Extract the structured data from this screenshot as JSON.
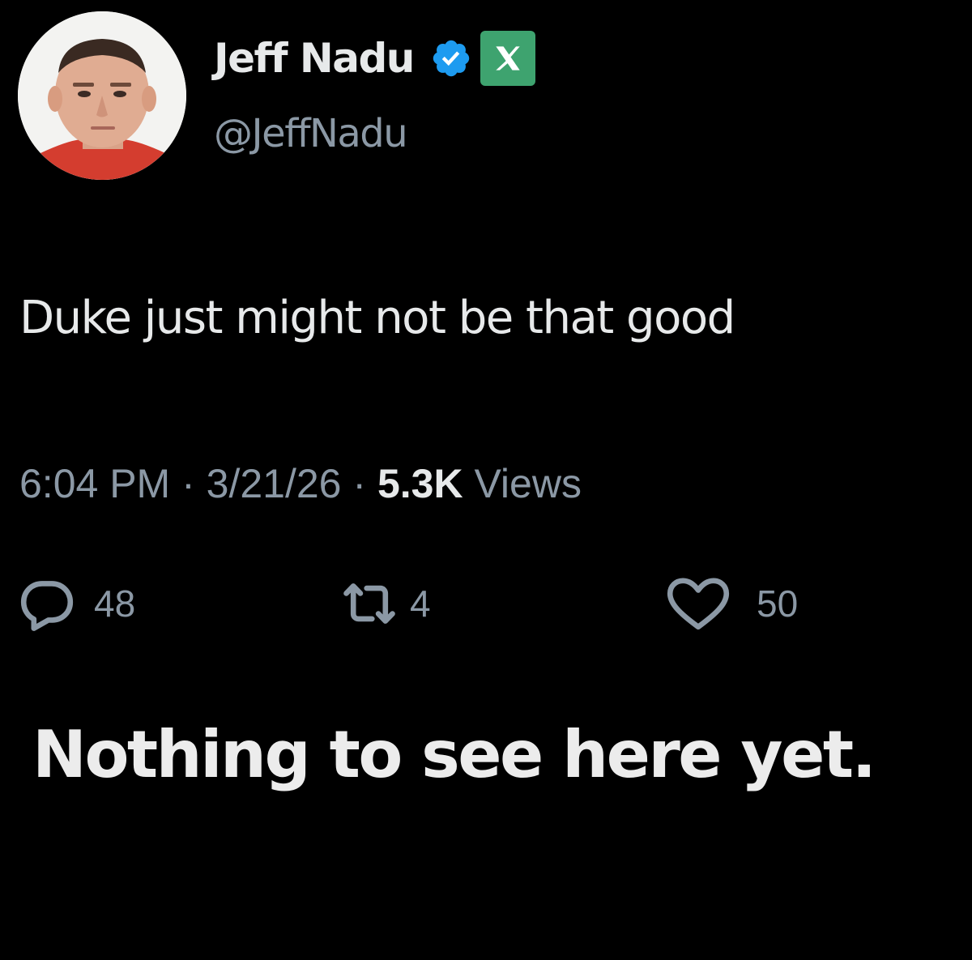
{
  "tweet": {
    "author": {
      "display_name": "Jeff Nadu",
      "handle": "@JeffNadu",
      "verified_icon": "verified-badge-icon",
      "affiliate_icon": "x-logo-icon",
      "badge_color": "#1d9bf0",
      "affiliate_color": "#3ea36f"
    },
    "text": "Duke just might not be that good",
    "meta": {
      "time": "6:04 PM",
      "separator": "·",
      "date": "3/21/26",
      "views_count": "5.3K",
      "views_label": "Views"
    },
    "actions": {
      "replies": "48",
      "reposts": "4",
      "likes": "50"
    }
  },
  "caption": "Nothing to see here yet."
}
